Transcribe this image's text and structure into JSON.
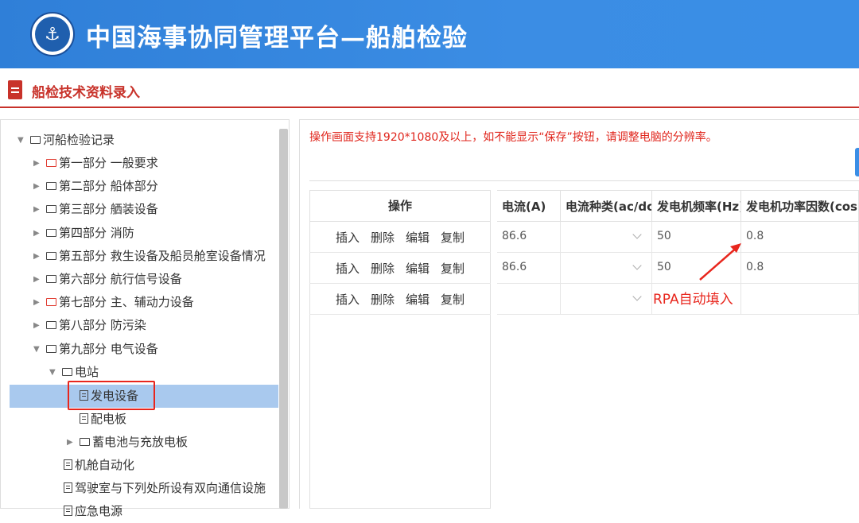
{
  "header": {
    "title": "中国海事协同管理平台—船舶检验",
    "logo_icon": "anchor-icon"
  },
  "subheader": {
    "title": "船检技术资料录入"
  },
  "tree": {
    "root": "河船检验记录",
    "parts": [
      {
        "label": "第一部分 一般要求",
        "red": true
      },
      {
        "label": "第二部分 船体部分",
        "red": false
      },
      {
        "label": "第三部分 舾装设备",
        "red": false
      },
      {
        "label": "第四部分 消防",
        "red": false
      },
      {
        "label": "第五部分 救生设备及船员舱室设备情况",
        "red": false
      },
      {
        "label": "第六部分 航行信号设备",
        "red": false
      },
      {
        "label": "第七部分 主、辅动力设备",
        "red": true
      },
      {
        "label": "第八部分 防污染",
        "red": false
      },
      {
        "label": "第九部分 电气设备",
        "red": false
      }
    ],
    "station": "电站",
    "generator": "发电设备",
    "distribution": "配电板",
    "battery": "蓄电池与充放电板",
    "engine_auto": "机舱自动化",
    "bridge_comm": "驾驶室与下列处所设有双向通信设施",
    "last_partial": "应急电源"
  },
  "notice": "操作画面支持1920*1080及以上，如不能显示“保存”按钮，请调整电脑的分辨率。",
  "table": {
    "op_header": "操作",
    "columns": [
      "电流(A)",
      "电流种类(ac/dc)",
      "发电机频率(Hz)",
      "发电机功率因数(cos"
    ],
    "actions": [
      "插入",
      "删除",
      "编辑",
      "复制"
    ],
    "rows": [
      {
        "current": "86.6",
        "type": "",
        "freq": "50",
        "pf": "0.8"
      },
      {
        "current": "86.6",
        "type": "",
        "freq": "50",
        "pf": "0.8"
      },
      {
        "current": "",
        "type": "",
        "freq": "",
        "pf": ""
      }
    ]
  },
  "annotation": {
    "text": "RPA自动填入",
    "color": "#e8261d"
  }
}
